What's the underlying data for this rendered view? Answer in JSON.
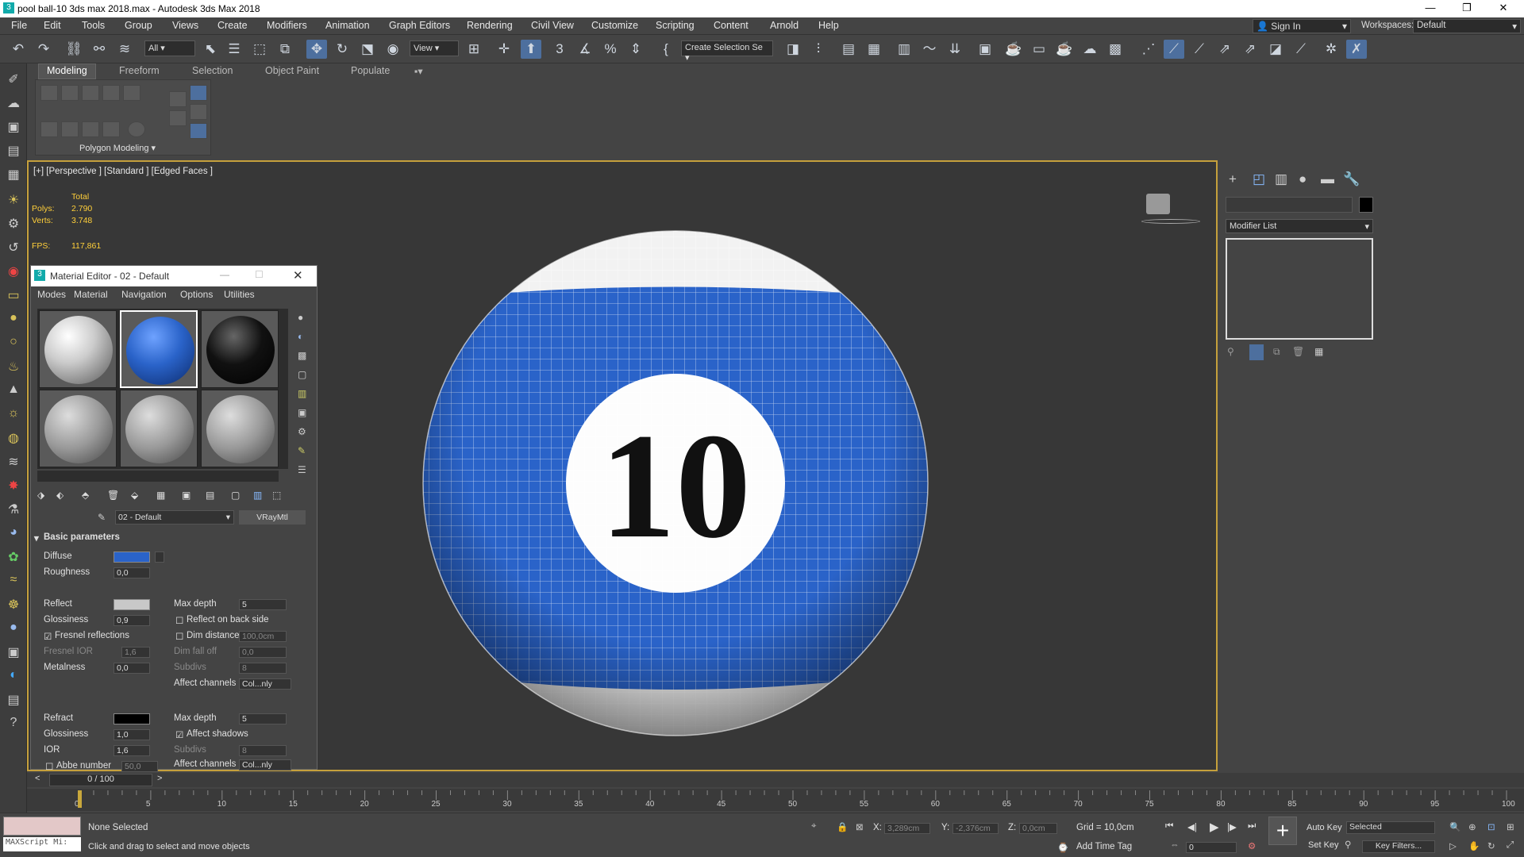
{
  "title": "pool ball-10 3ds max 2018.max - Autodesk 3ds Max 2018",
  "window_controls": {
    "minimize": "—",
    "restore": "❐",
    "close": "✕"
  },
  "menu": [
    "File",
    "Edit",
    "Tools",
    "Group",
    "Views",
    "Create",
    "Modifiers",
    "Animation",
    "Graph Editors",
    "Rendering",
    "Civil View",
    "Customize",
    "Scripting",
    "Content",
    "Arnold",
    "Help"
  ],
  "signin": "Sign In",
  "workspaces_label": "Workspaces:",
  "workspaces_value": "Default",
  "toolbar": {
    "filter": "All",
    "view": "View",
    "selection_set": "Create Selection Se"
  },
  "ribbon": {
    "tabs": [
      "Modeling",
      "Freeform",
      "Selection",
      "Object Paint",
      "Populate"
    ],
    "panel": "Polygon Modeling ▾"
  },
  "viewport": {
    "label": "[+] [Perspective ] [Standard ] [Edged Faces ]",
    "total": "Total",
    "polys_label": "Polys:",
    "polys": "2.790",
    "verts_label": "Verts:",
    "verts": "3.748",
    "fps_label": "FPS:",
    "fps": "117,861",
    "ball_number": "10",
    "ball_color": "#2a63c9"
  },
  "material_editor": {
    "title": "Material Editor - 02 - Default",
    "menu": [
      "Modes",
      "Material",
      "Navigation",
      "Options",
      "Utilities"
    ],
    "mat_name": "02 - Default",
    "mat_type": "VRayMtl",
    "rollout": "Basic parameters",
    "diffuse": "Diffuse",
    "roughness": "Roughness",
    "roughness_val": "0,0",
    "reflect": "Reflect",
    "glossiness": "Glossiness",
    "glossiness_val": "0,9",
    "fresnel": "Fresnel reflections",
    "fresnel_ior": "Fresnel IOR",
    "fresnel_ior_val": "1,6",
    "metalness": "Metalness",
    "metalness_val": "0,0",
    "max_depth": "Max depth",
    "max_depth_val": "5",
    "reflect_back": "Reflect on back side",
    "dim_distance": "Dim distance",
    "dim_distance_val": "100,0cm",
    "dim_fall_off": "Dim fall off",
    "dim_fall_off_val": "0,0",
    "subdivs": "Subdivs",
    "subdivs_val": "8",
    "affect_channels": "Affect channels",
    "affect_val": "Col...nly",
    "refract": "Refract",
    "r_glossiness": "Glossiness",
    "r_glossiness_val": "1,0",
    "ior": "IOR",
    "ior_val": "1,6",
    "abbe": "Abbe number",
    "abbe_val": "50,0",
    "r_max_depth": "Max depth",
    "r_max_depth_val": "5",
    "affect_shadows": "Affect shadows",
    "r_subdivs": "Subdivs",
    "r_subdivs_val": "8",
    "r_affect_channels": "Affect channels",
    "r_affect_val": "Col...nly"
  },
  "command_panel": {
    "modifier_list": "Modifier List"
  },
  "timeslider": {
    "value": "0 / 100",
    "ticks": [
      "0",
      "5",
      "10",
      "15",
      "20",
      "25",
      "30",
      "35",
      "40",
      "45",
      "50",
      "55",
      "60",
      "65",
      "70",
      "75",
      "80",
      "85",
      "90",
      "95",
      "100"
    ]
  },
  "status": {
    "maxscript": "MAXScript Mi:",
    "selected": "None Selected",
    "prompt": "Click and drag to select and move objects",
    "x_label": "X:",
    "x": "3,289cm",
    "y_label": "Y:",
    "y": "-2,376cm",
    "z_label": "Z:",
    "z": "0,0cm",
    "grid": "Grid = 10,0cm",
    "add_time_tag": "Add Time Tag",
    "auto_key": "Auto Key",
    "set_key": "Set Key",
    "selected_dd": "Selected",
    "key_filters": "Key Filters...",
    "frame": "0"
  }
}
